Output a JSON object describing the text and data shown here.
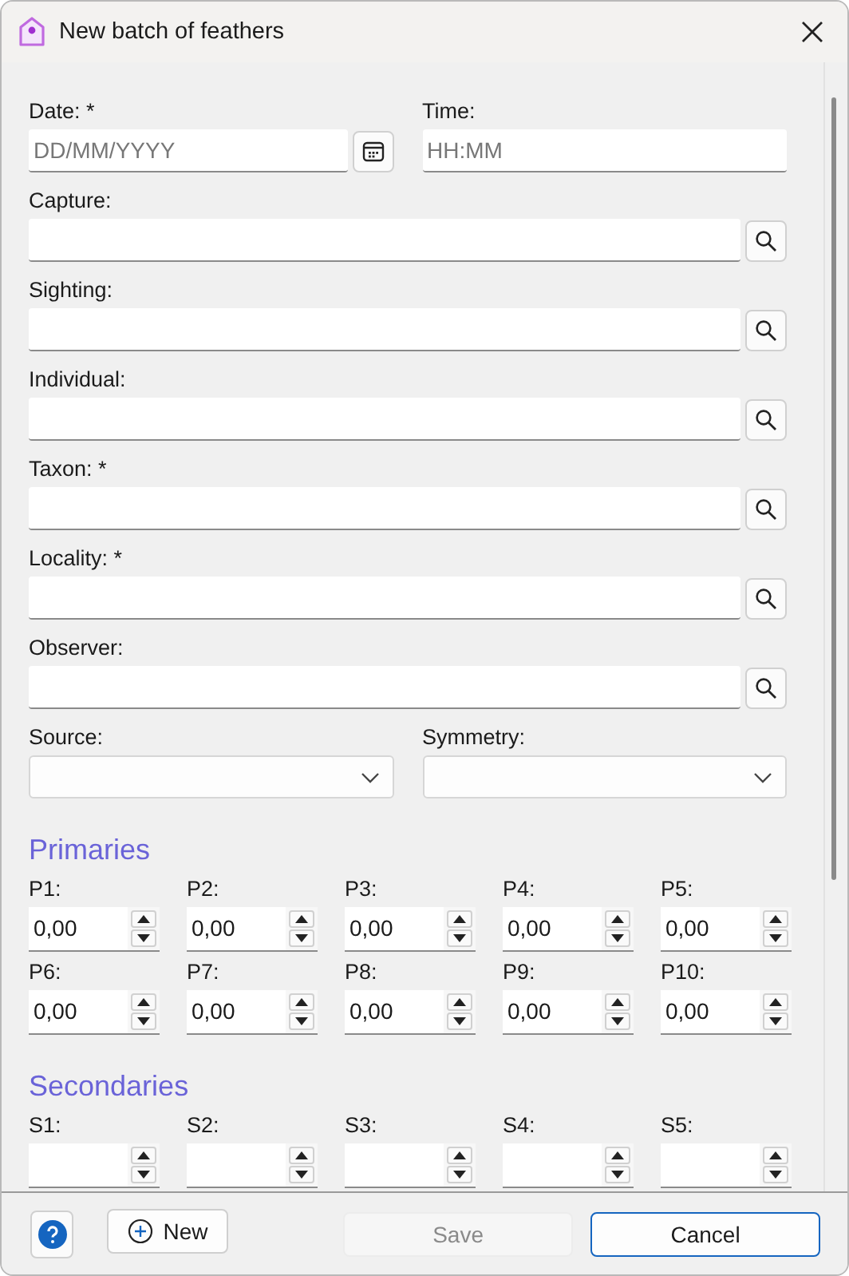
{
  "window": {
    "title": "New batch of feathers"
  },
  "fields": [
    {
      "label": "Date: *",
      "kind": "date",
      "placeholder": "DD/MM/YYYY"
    },
    {
      "label": "Time:",
      "kind": "time",
      "placeholder": "HH:MM"
    },
    {
      "label": "Capture:",
      "kind": "lookup"
    },
    {
      "label": "Sighting:",
      "kind": "lookup"
    },
    {
      "label": "Individual:",
      "kind": "lookup"
    },
    {
      "label": "Taxon: *",
      "kind": "lookup"
    },
    {
      "label": "Locality: *",
      "kind": "lookup"
    },
    {
      "label": "Observer:",
      "kind": "lookup"
    },
    {
      "label": "Source:",
      "kind": "dropdown"
    },
    {
      "label": "Symmetry:",
      "kind": "dropdown"
    }
  ],
  "sections": [
    {
      "title": "Primaries",
      "items": [
        {
          "label": "P1:",
          "value": "0,00"
        },
        {
          "label": "P2:",
          "value": "0,00"
        },
        {
          "label": "P3:",
          "value": "0,00"
        },
        {
          "label": "P4:",
          "value": "0,00"
        },
        {
          "label": "P5:",
          "value": "0,00"
        },
        {
          "label": "P6:",
          "value": "0,00"
        },
        {
          "label": "P7:",
          "value": "0,00"
        },
        {
          "label": "P8:",
          "value": "0,00"
        },
        {
          "label": "P9:",
          "value": "0,00"
        },
        {
          "label": "P10:",
          "value": "0,00"
        }
      ]
    },
    {
      "title": "Secondaries",
      "items": [
        {
          "label": "S1:"
        },
        {
          "label": "S2:"
        },
        {
          "label": "S3:"
        },
        {
          "label": "S4:"
        },
        {
          "label": "S5:"
        }
      ]
    }
  ],
  "buttons": [
    {
      "label": "New",
      "kind": "new",
      "disabled": false,
      "focused": false
    },
    {
      "label": "Save",
      "kind": "plain",
      "disabled": true,
      "focused": false
    },
    {
      "label": "Cancel",
      "kind": "plain",
      "disabled": false,
      "focused": true
    }
  ]
}
